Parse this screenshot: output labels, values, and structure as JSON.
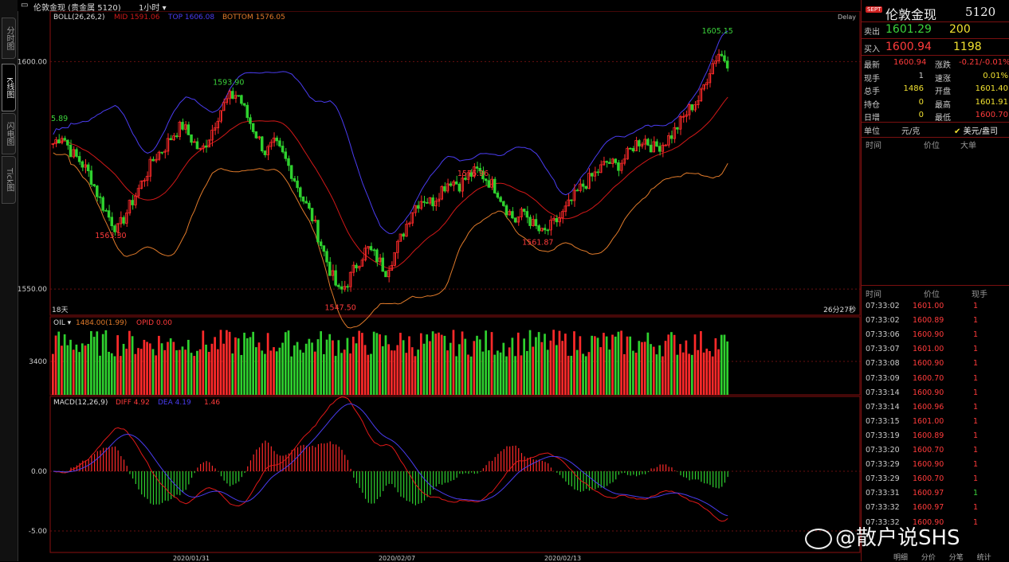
{
  "side_tabs": [
    "分时图",
    "K线图",
    "闪电图",
    "Tick图"
  ],
  "topbar": {
    "window_icon": "window-icon",
    "instrument": "伦敦金现 (贵金属 5120)",
    "period": "1小时"
  },
  "indicators": {
    "boll": {
      "name": "BOLL(26,26,2)",
      "mid": "MID 1591.06",
      "top": "TOP 1606.08",
      "bottom": "BOTTOM 1576.05"
    },
    "oi": {
      "name": "OIL",
      "value": "1484.00(1.99)",
      "opid": "OPID 0.00"
    },
    "macd": {
      "name": "MACD(12,26,9)",
      "diff": "DIFF 4.92",
      "dea": "DEA 4.19",
      "macd": "1.46"
    }
  },
  "delay_label": "Delay",
  "span_left": "18天",
  "span_right": "26分27秒",
  "colors": {
    "up": "#ff2a2a",
    "down": "#2fd12f",
    "boll_top": "#4a3cf0",
    "boll_mid": "#d01818",
    "boll_bot": "#e07a2a",
    "frame": "#8a1010",
    "axis_text": "#cccccc"
  },
  "chart_data": {
    "type": "candlestick",
    "price_axis": {
      "ticks": [
        1600.0,
        1550.0
      ],
      "tick_labels": [
        "1600.00",
        "1550.00"
      ],
      "ylim": [
        1546,
        1609
      ]
    },
    "x_labels": [
      "2020/01/31",
      "2020/02/07",
      "2020/02/13"
    ],
    "annotations": [
      {
        "label": "5.89",
        "price": 1585.89
      },
      {
        "label": "1593.90",
        "price": 1593.9
      },
      {
        "label": "1563.30",
        "price": 1563.3
      },
      {
        "label": "1547.50",
        "price": 1547.5
      },
      {
        "label": "1576.96",
        "price": 1576.96
      },
      {
        "label": "1561.87",
        "price": 1561.87
      },
      {
        "label": "1605.15",
        "price": 1605.15
      }
    ],
    "close_path": [
      1582,
      1584,
      1580,
      1578,
      1575,
      1570,
      1566,
      1563,
      1567,
      1571,
      1575,
      1579,
      1581,
      1584,
      1586,
      1583,
      1580,
      1584,
      1589,
      1592,
      1593,
      1588,
      1584,
      1580,
      1582,
      1579,
      1575,
      1570,
      1566,
      1560,
      1554,
      1549,
      1552,
      1556,
      1559,
      1557,
      1554,
      1558,
      1563,
      1568,
      1570,
      1569,
      1572,
      1574,
      1573,
      1575,
      1576,
      1574,
      1572,
      1568,
      1565,
      1567,
      1564,
      1562,
      1564,
      1566,
      1569,
      1572,
      1574,
      1576,
      1578,
      1577,
      1579,
      1582,
      1583,
      1581,
      1582,
      1584,
      1587,
      1590,
      1592,
      1598,
      1602,
      1600
    ],
    "volume_axis": {
      "tick_label": "3400"
    },
    "macd_axis": {
      "tick_labels": [
        "0.00",
        "-5.00"
      ]
    }
  },
  "right_panel": {
    "badge": "SEPT",
    "title": "伦敦金现",
    "code": "5120",
    "sell_label": "卖出",
    "sell_price": "1601.29",
    "sell_qty": "200",
    "buy_label": "买入",
    "buy_price": "1600.94",
    "buy_qty": "1198",
    "stats": [
      {
        "l1": "最新",
        "v1": "1600.94",
        "c1": "red",
        "l2": "涨跌",
        "v2": "-0.21/-0.01%",
        "c2": "red"
      },
      {
        "l1": "现手",
        "v1": "1",
        "c1": "lbl",
        "l2": "速涨",
        "v2": "0.01%",
        "c2": "yel"
      },
      {
        "l1": "总手",
        "v1": "1486",
        "c1": "yel",
        "l2": "开盘",
        "v2": "1601.40",
        "c2": "yel"
      },
      {
        "l1": "持仓",
        "v1": "0",
        "c1": "yel",
        "l2": "最高",
        "v2": "1601.91",
        "c2": "yel"
      },
      {
        "l1": "日增",
        "v1": "0",
        "c1": "yel",
        "l2": "最低",
        "v2": "1600.70",
        "c2": "red"
      }
    ],
    "unit_label": "单位",
    "unit_value": "元/克",
    "unit_check": "美元/盎司",
    "book_headers": [
      "时间",
      "价位",
      "大单"
    ],
    "trade_headers": [
      "时间",
      "价位",
      "现手"
    ],
    "trades": [
      {
        "time": "07:33:02",
        "price": "1601.00",
        "qty": "1",
        "color": "red"
      },
      {
        "time": "07:33:02",
        "price": "1600.89",
        "qty": "1",
        "color": "red"
      },
      {
        "time": "07:33:06",
        "price": "1600.90",
        "qty": "1",
        "color": "red"
      },
      {
        "time": "07:33:07",
        "price": "1601.00",
        "qty": "1",
        "color": "red"
      },
      {
        "time": "07:33:08",
        "price": "1600.90",
        "qty": "1",
        "color": "red"
      },
      {
        "time": "07:33:09",
        "price": "1600.70",
        "qty": "1",
        "color": "red"
      },
      {
        "time": "07:33:14",
        "price": "1600.90",
        "qty": "1",
        "color": "red"
      },
      {
        "time": "07:33:14",
        "price": "1600.96",
        "qty": "1",
        "color": "red"
      },
      {
        "time": "07:33:15",
        "price": "1601.00",
        "qty": "1",
        "color": "red"
      },
      {
        "time": "07:33:19",
        "price": "1600.89",
        "qty": "1",
        "color": "red"
      },
      {
        "time": "07:33:20",
        "price": "1600.70",
        "qty": "1",
        "color": "red"
      },
      {
        "time": "07:33:29",
        "price": "1600.90",
        "qty": "1",
        "color": "red"
      },
      {
        "time": "07:33:29",
        "price": "1600.70",
        "qty": "1",
        "color": "red"
      },
      {
        "time": "07:33:31",
        "price": "1600.97",
        "qty": "1",
        "color": "grn"
      },
      {
        "time": "07:33:32",
        "price": "1600.97",
        "qty": "1",
        "color": "red"
      },
      {
        "time": "07:33:32",
        "price": "1600.90",
        "qty": "1",
        "color": "red"
      }
    ],
    "bottom_tabs": [
      "明细",
      "分价",
      "分笔",
      "统计"
    ]
  },
  "watermark": "@散户说SHS"
}
